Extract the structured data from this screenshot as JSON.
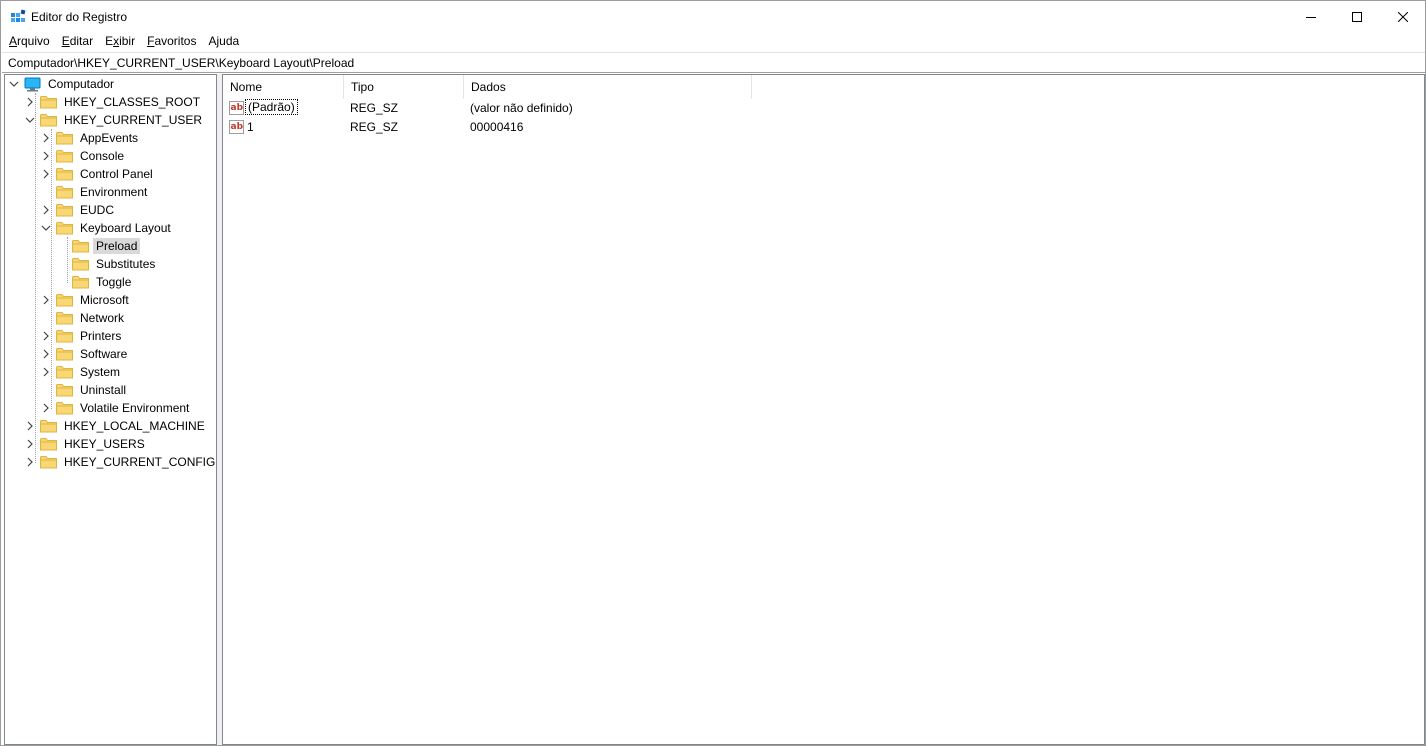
{
  "window": {
    "title": "Editor do Registro"
  },
  "menu": [
    {
      "label": "Arquivo",
      "key": "A",
      "rest": "rquivo"
    },
    {
      "label": "Editar",
      "key": "E",
      "rest": "ditar"
    },
    {
      "label": "Exibir",
      "key": "x",
      "pre": "E",
      "rest": "ibir"
    },
    {
      "label": "Favoritos",
      "key": "F",
      "rest": "avoritos"
    },
    {
      "label": "Ajuda",
      "key": "j",
      "pre": "A",
      "rest": "uda"
    }
  ],
  "address": "Computador\\HKEY_CURRENT_USER\\Keyboard Layout\\Preload",
  "tree": {
    "root": "Computador",
    "nodes": [
      {
        "label": "HKEY_CLASSES_ROOT"
      },
      {
        "label": "HKEY_CURRENT_USER"
      },
      {
        "label": "AppEvents"
      },
      {
        "label": "Console"
      },
      {
        "label": "Control Panel"
      },
      {
        "label": "Environment"
      },
      {
        "label": "EUDC"
      },
      {
        "label": "Keyboard Layout"
      },
      {
        "label": "Preload"
      },
      {
        "label": "Substitutes"
      },
      {
        "label": "Toggle"
      },
      {
        "label": "Microsoft"
      },
      {
        "label": "Network"
      },
      {
        "label": "Printers"
      },
      {
        "label": "Software"
      },
      {
        "label": "System"
      },
      {
        "label": "Uninstall"
      },
      {
        "label": "Volatile Environment"
      },
      {
        "label": "HKEY_LOCAL_MACHINE"
      },
      {
        "label": "HKEY_USERS"
      },
      {
        "label": "HKEY_CURRENT_CONFIG"
      }
    ]
  },
  "list": {
    "columns": {
      "name": "Nome",
      "type": "Tipo",
      "data": "Dados"
    },
    "rows": [
      {
        "name": "(Padrão)",
        "type": "REG_SZ",
        "data": "(valor não definido)"
      },
      {
        "name": "1",
        "type": "REG_SZ",
        "data": "00000416"
      }
    ]
  },
  "colors": {
    "folder": "#f8d775",
    "folder_edge": "#e0b440",
    "selection": "#d9d9d9",
    "string_icon": "#c0392b"
  }
}
